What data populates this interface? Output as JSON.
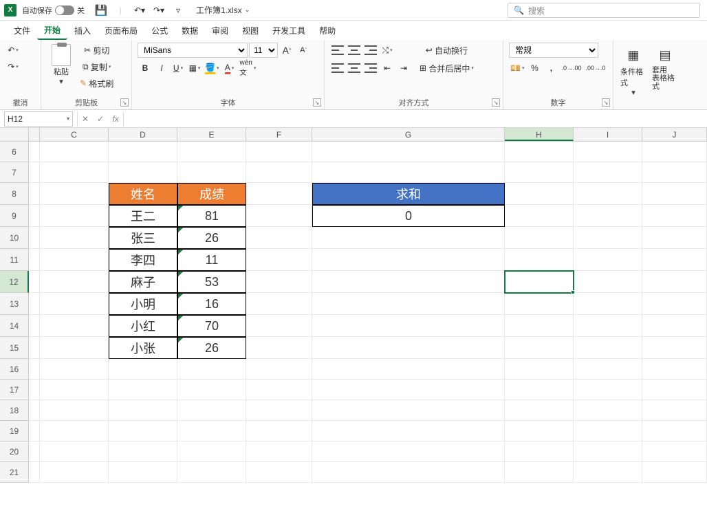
{
  "titlebar": {
    "autosave_label": "自动保存",
    "autosave_state": "关",
    "doc_name": "工作簿1.xlsx",
    "search_placeholder": "搜索"
  },
  "menu": {
    "file": "文件",
    "home": "开始",
    "insert": "插入",
    "layout": "页面布局",
    "formulas": "公式",
    "data": "数据",
    "review": "审阅",
    "view": "视图",
    "dev": "开发工具",
    "help": "帮助"
  },
  "ribbon": {
    "undo_group": "撤消",
    "clipboard_group": "剪贴板",
    "paste": "粘贴",
    "cut": "剪切",
    "copy": "复制",
    "format_painter": "格式刷",
    "font_group": "字体",
    "font_name": "MiSans",
    "font_size": "11",
    "align_group": "对齐方式",
    "wrap_text": "自动换行",
    "merge_center": "合并后居中",
    "number_group": "数字",
    "number_format": "常规",
    "cond_fmt": "条件格式",
    "table_fmt": "套用\n表格格式"
  },
  "namebox": "H12",
  "formula_value": "",
  "columns": [
    "C",
    "D",
    "E",
    "F",
    "G",
    "H",
    "I",
    "J"
  ],
  "rows": [
    6,
    7,
    8,
    9,
    10,
    11,
    12,
    13,
    14,
    15,
    16,
    17,
    18,
    19,
    20,
    21
  ],
  "selected_cell": "H12",
  "table1": {
    "headers": [
      "姓名",
      "成绩"
    ],
    "rows": [
      [
        "王二",
        "81"
      ],
      [
        "张三",
        "26"
      ],
      [
        "李四",
        "11"
      ],
      [
        "麻子",
        "53"
      ],
      [
        "小明",
        "16"
      ],
      [
        "小红",
        "70"
      ],
      [
        "小张",
        "26"
      ]
    ]
  },
  "table2": {
    "header": "求和",
    "value": "0"
  }
}
